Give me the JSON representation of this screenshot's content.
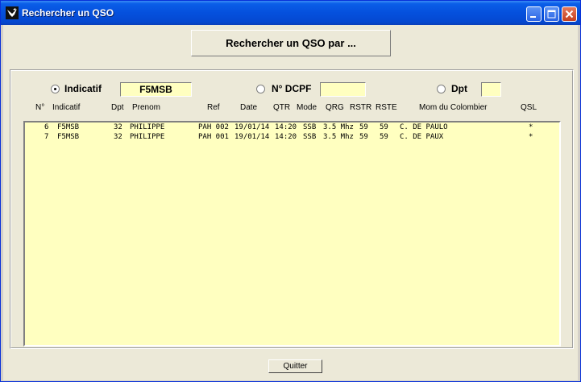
{
  "window": {
    "title": "Rechercher un QSO"
  },
  "search_button": "Rechercher un QSO par ...",
  "filters": {
    "indicatif": {
      "label": "Indicatif",
      "value": "F5MSB",
      "checked": true
    },
    "dcpf": {
      "label": "N° DCPF",
      "value": "",
      "checked": false
    },
    "dpt": {
      "label": "Dpt",
      "value": "",
      "checked": false
    }
  },
  "columns": [
    "N°",
    "Indicatif",
    "Dpt",
    "Prenom",
    "Ref",
    "Date",
    "QTR",
    "Mode",
    "QRG",
    "RSTR",
    "RSTE",
    "Mom du Colombier",
    "QSL"
  ],
  "rows": [
    {
      "n": "6",
      "indicatif": "F5MSB",
      "dpt": "32",
      "prenom": "PHILIPPE",
      "ref": "PAH 002",
      "date": "19/01/14",
      "qtr": "14:20",
      "mode": "SSB",
      "qrg": "3.5 Mhz",
      "rstr": "59",
      "rste": "59",
      "colombier": "C. DE PAULO",
      "qsl": "*"
    },
    {
      "n": "7",
      "indicatif": "F5MSB",
      "dpt": "32",
      "prenom": "PHILIPPE",
      "ref": "PAH 001",
      "date": "19/01/14",
      "qtr": "14:20",
      "mode": "SSB",
      "qrg": "3.5 Mhz",
      "rstr": "59",
      "rste": "59",
      "colombier": "C. DE PAUX",
      "qsl": "*"
    }
  ],
  "quit_button": "Quitter",
  "icons": {
    "app": "pigeon-icon",
    "minimize": "minimize-icon",
    "maximize": "maximize-icon",
    "close": "close-icon"
  },
  "colors": {
    "title_bar": "#0550dd",
    "field_bg": "#ffffc0",
    "window_bg": "#ece9d8"
  }
}
